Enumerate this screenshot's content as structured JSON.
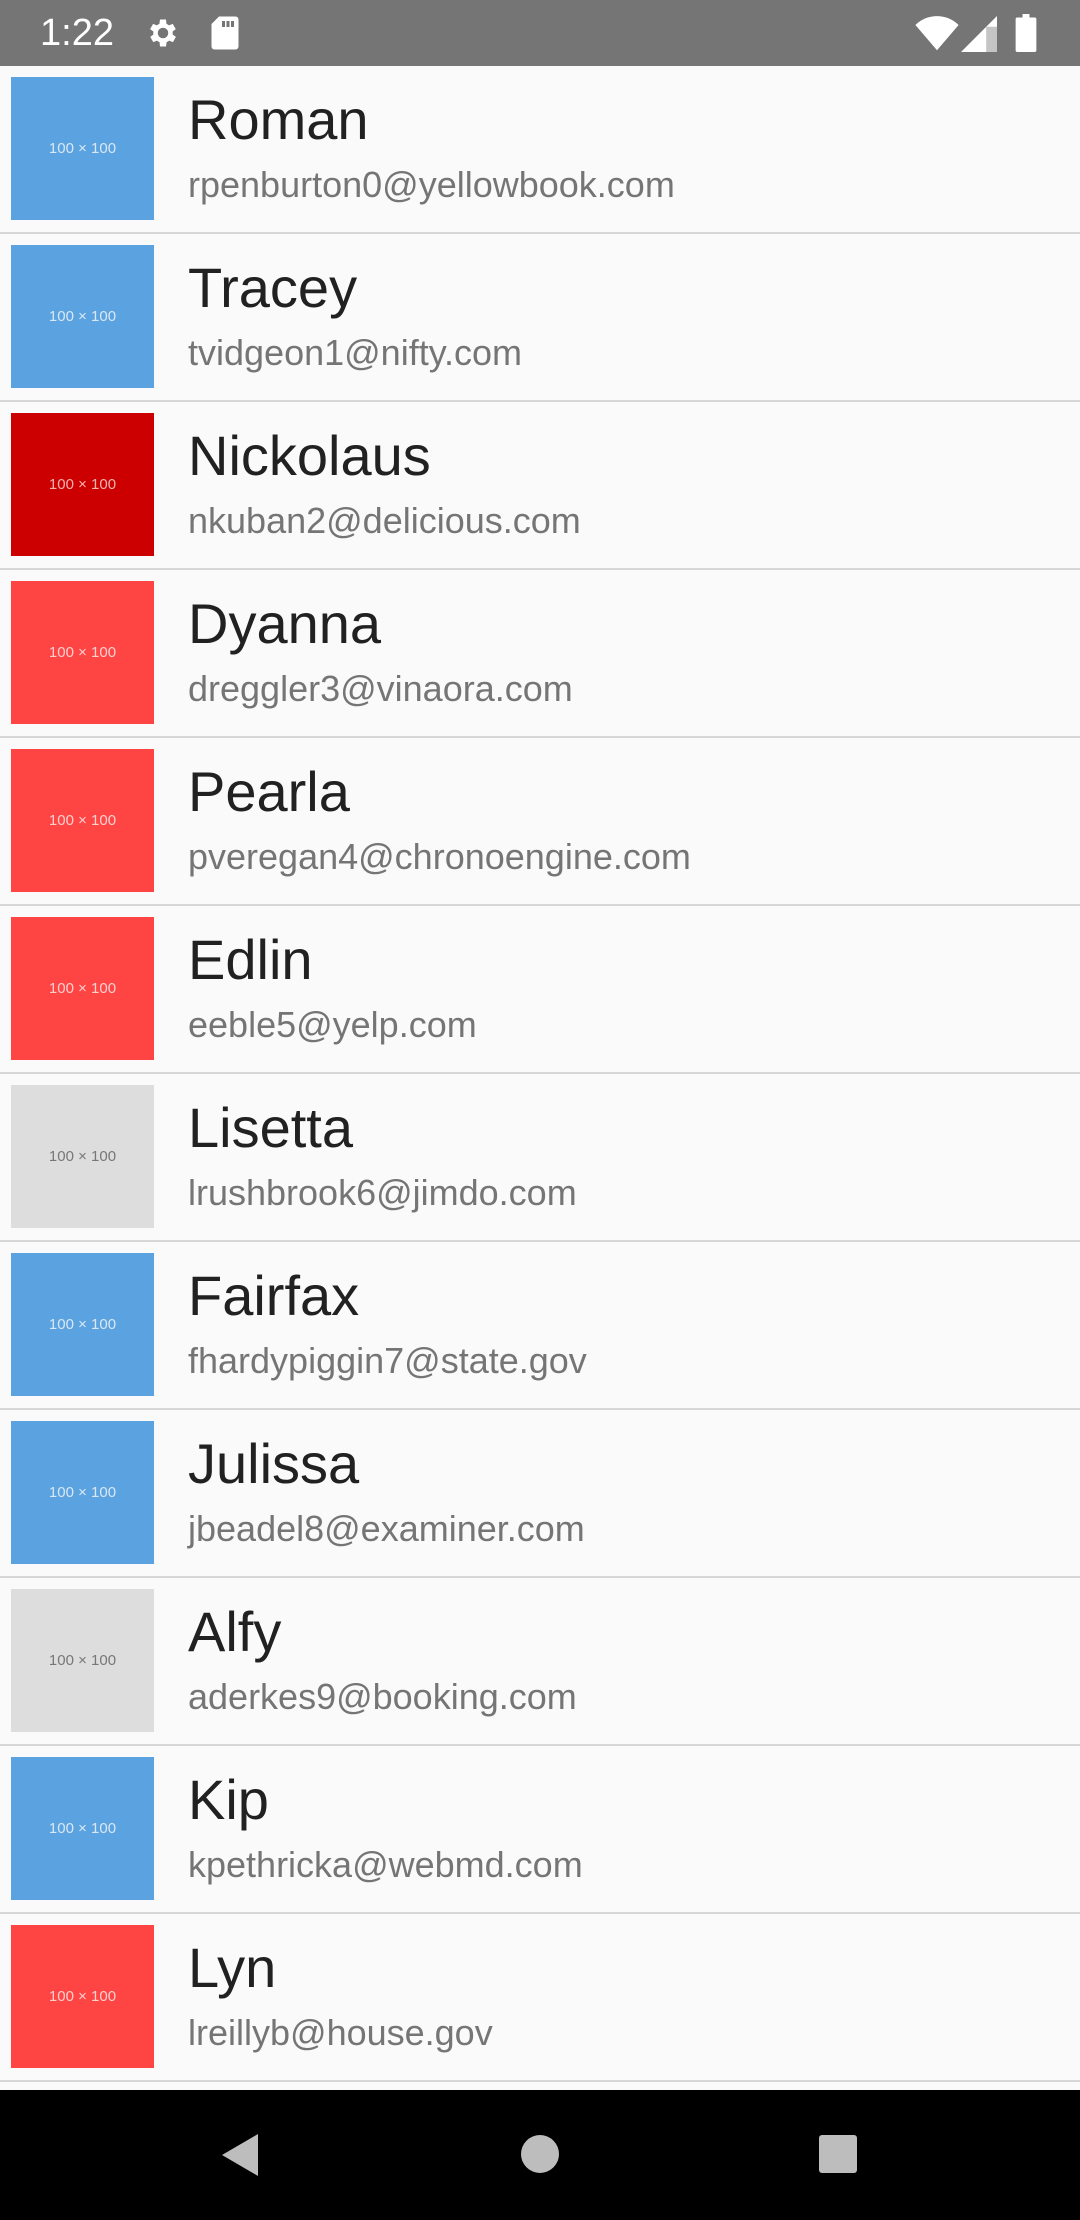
{
  "status_bar": {
    "time": "1:22",
    "icons": [
      "gear-icon",
      "sd-card-icon",
      "wifi-icon",
      "signal-icon",
      "battery-icon"
    ]
  },
  "contacts": [
    {
      "name": "Roman",
      "email": "rpenburton0@yellowbook.com",
      "thumb_label": "100 × 100",
      "thumb_color": "#5ba3e0",
      "label_color": "#d8e8f5"
    },
    {
      "name": "Tracey",
      "email": "tvidgeon1@nifty.com",
      "thumb_label": "100 × 100",
      "thumb_color": "#5ba3e0",
      "label_color": "#d8e8f5"
    },
    {
      "name": "Nickolaus",
      "email": "nkuban2@delicious.com",
      "thumb_label": "100 × 100",
      "thumb_color": "#cc0000",
      "label_color": "#f2b3b3"
    },
    {
      "name": "Dyanna",
      "email": "dreggler3@vinaora.com",
      "thumb_label": "100 × 100",
      "thumb_color": "#ff4444",
      "label_color": "#ffd0d0"
    },
    {
      "name": "Pearla",
      "email": "pveregan4@chronoengine.com",
      "thumb_label": "100 × 100",
      "thumb_color": "#ff4444",
      "label_color": "#ffd0d0"
    },
    {
      "name": "Edlin",
      "email": "eeble5@yelp.com",
      "thumb_label": "100 × 100",
      "thumb_color": "#ff4444",
      "label_color": "#ffd0d0"
    },
    {
      "name": "Lisetta",
      "email": "lrushbrook6@jimdo.com",
      "thumb_label": "100 × 100",
      "thumb_color": "#dddddd",
      "label_color": "#777777"
    },
    {
      "name": "Fairfax",
      "email": "fhardypiggin7@state.gov",
      "thumb_label": "100 × 100",
      "thumb_color": "#5ba3e0",
      "label_color": "#d8e8f5"
    },
    {
      "name": "Julissa",
      "email": "jbeadel8@examiner.com",
      "thumb_label": "100 × 100",
      "thumb_color": "#5ba3e0",
      "label_color": "#d8e8f5"
    },
    {
      "name": "Alfy",
      "email": "aderkes9@booking.com",
      "thumb_label": "100 × 100",
      "thumb_color": "#dddddd",
      "label_color": "#777777"
    },
    {
      "name": "Kip",
      "email": "kpethricka@webmd.com",
      "thumb_label": "100 × 100",
      "thumb_color": "#5ba3e0",
      "label_color": "#d8e8f5"
    },
    {
      "name": "Lyn",
      "email": "lreillyb@house.gov",
      "thumb_label": "100 × 100",
      "thumb_color": "#ff4444",
      "label_color": "#ffd0d0"
    }
  ],
  "nav_bar": {
    "icons": [
      "back-icon",
      "home-icon",
      "recents-icon"
    ]
  }
}
